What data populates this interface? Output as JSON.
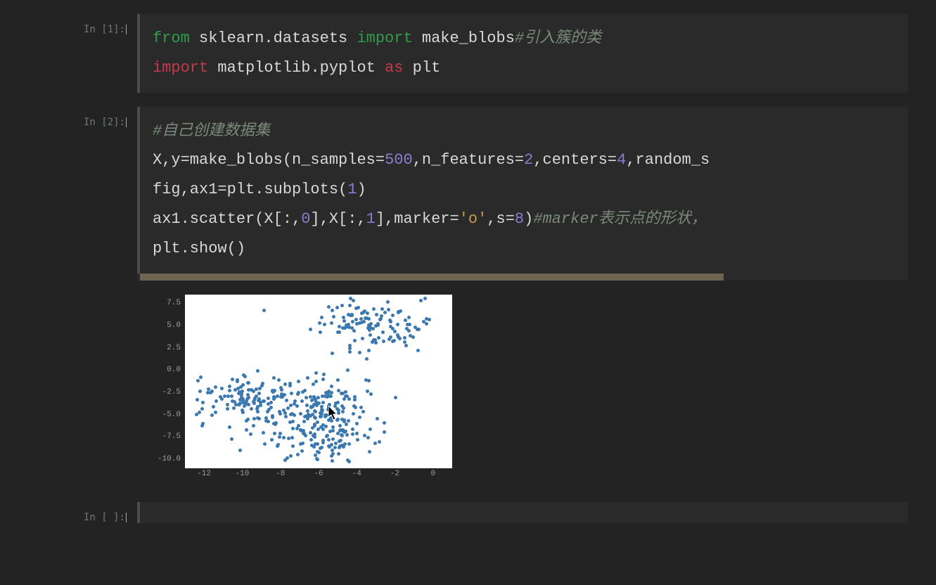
{
  "cells": [
    {
      "prompt": "In [1]:",
      "lines": [
        [
          {
            "cls": "kw-green",
            "t": "from"
          },
          {
            "cls": "plain",
            "t": " sklearn.datasets "
          },
          {
            "cls": "kw-green",
            "t": "import"
          },
          {
            "cls": "plain",
            "t": " make_blobs"
          },
          {
            "cls": "comment",
            "t": "#引入簇的类"
          }
        ],
        [
          {
            "cls": "kw-red",
            "t": "import"
          },
          {
            "cls": "plain",
            "t": " matplotlib.pyplot "
          },
          {
            "cls": "kw-red",
            "t": "as"
          },
          {
            "cls": "plain",
            "t": " plt"
          }
        ]
      ]
    },
    {
      "prompt": "In [2]:",
      "lines": [
        [
          {
            "cls": "comment",
            "t": "#自己创建数据集"
          }
        ],
        [
          {
            "cls": "plain",
            "t": "X,y=make_blobs(n_samples="
          },
          {
            "cls": "num",
            "t": "500"
          },
          {
            "cls": "plain",
            "t": ",n_features="
          },
          {
            "cls": "num",
            "t": "2"
          },
          {
            "cls": "plain",
            "t": ",centers="
          },
          {
            "cls": "num",
            "t": "4"
          },
          {
            "cls": "plain",
            "t": ",random_s"
          }
        ],
        [
          {
            "cls": "plain",
            "t": "fig,ax1=plt.subplots("
          },
          {
            "cls": "num",
            "t": "1"
          },
          {
            "cls": "plain",
            "t": ")"
          }
        ],
        [
          {
            "cls": "plain",
            "t": "ax1.scatter(X[:,"
          },
          {
            "cls": "num",
            "t": "0"
          },
          {
            "cls": "plain",
            "t": "],X[:,"
          },
          {
            "cls": "num",
            "t": "1"
          },
          {
            "cls": "plain",
            "t": "],marker="
          },
          {
            "cls": "str",
            "t": "'o'"
          },
          {
            "cls": "plain",
            "t": ",s="
          },
          {
            "cls": "num",
            "t": "8"
          },
          {
            "cls": "plain",
            "t": ")"
          },
          {
            "cls": "comment",
            "t": "#marker表示点的形状，"
          }
        ],
        [
          {
            "cls": "plain",
            "t": "plt.show()"
          }
        ]
      ],
      "scroll_thumb_pct": 76
    },
    {
      "prompt": "In [ ]:",
      "lines": []
    }
  ],
  "chart_data": {
    "type": "scatter",
    "xlabel": "",
    "ylabel": "",
    "xlim": [
      -13,
      1
    ],
    "ylim": [
      -11,
      8.5
    ],
    "xticks": [
      -12,
      -10,
      -8,
      -6,
      -4,
      -2,
      0
    ],
    "yticks": [
      7.5,
      5.0,
      2.5,
      0.0,
      -2.5,
      -5.0,
      -7.5,
      -10.0
    ],
    "xtick_labels": [
      "-12",
      "-10",
      "-8",
      "-6",
      "-4",
      "-2",
      "0"
    ],
    "ytick_labels": [
      "7.5",
      "5.0",
      "2.5",
      "0.0",
      "-2.5",
      "-5.0",
      "-7.5",
      "-10.0"
    ],
    "marker": "o",
    "marker_size": 8,
    "color": "#3b78b0",
    "n_points": 500,
    "clusters": [
      {
        "cx": -3.0,
        "cy": 5.0,
        "r": 1.4,
        "n": 125
      },
      {
        "cx": -10.0,
        "cy": -3.5,
        "r": 1.4,
        "n": 125
      },
      {
        "cx": -6.0,
        "cy": -3.5,
        "r": 1.4,
        "n": 125
      },
      {
        "cx": -6.0,
        "cy": -7.5,
        "r": 1.4,
        "n": 125
      }
    ]
  },
  "cursor_data_pos": {
    "x": -5.5,
    "y": -4.0
  }
}
